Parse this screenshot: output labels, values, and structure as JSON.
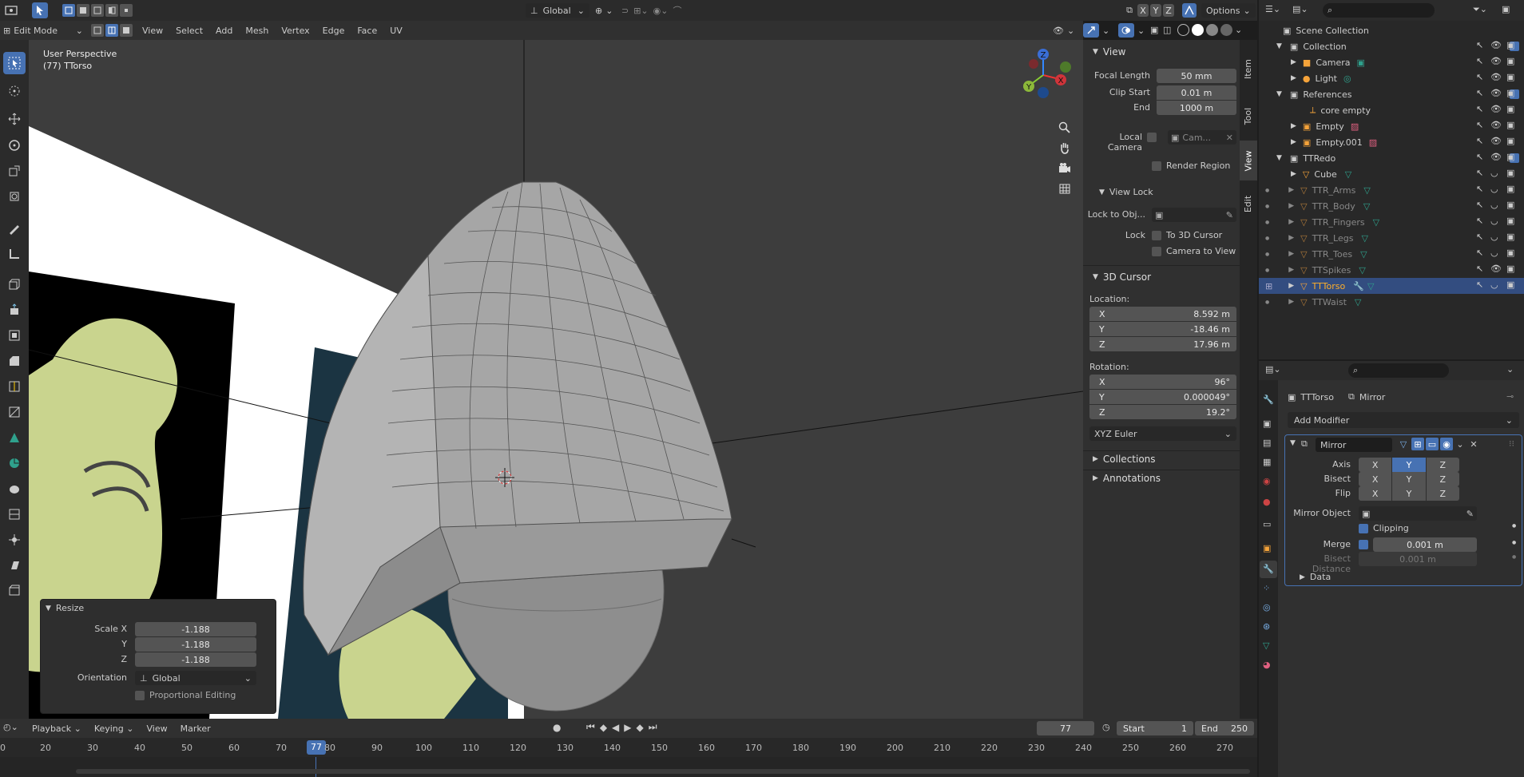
{
  "topbar": {
    "transform_orientation": "Global",
    "axes": [
      "X",
      "Y",
      "Z"
    ],
    "options_label": "Options"
  },
  "header": {
    "mode": "Edit Mode",
    "menus": [
      "View",
      "Select",
      "Add",
      "Mesh",
      "Vertex",
      "Edge",
      "Face",
      "UV"
    ]
  },
  "viewport": {
    "perspective_label": "User Perspective",
    "object_label": "(77) TTorso"
  },
  "resize_panel": {
    "title": "Resize",
    "scale_x_label": "Scale X",
    "y_label": "Y",
    "z_label": "Z",
    "scale_x": "-1.188",
    "scale_y": "-1.188",
    "scale_z": "-1.188",
    "orientation_label": "Orientation",
    "orientation_value": "Global",
    "proportional_label": "Proportional Editing"
  },
  "npanel": {
    "view_title": "View",
    "focal_length_label": "Focal Length",
    "focal_length": "50 mm",
    "clip_start_label": "Clip Start",
    "clip_start": "0.01 m",
    "end_label": "End",
    "clip_end": "1000 m",
    "local_camera_label": "Local Camera",
    "local_camera_value": "Cam...",
    "render_region_label": "Render Region",
    "view_lock_title": "View Lock",
    "lock_to_obj_label": "Lock to Obj...",
    "lock_label": "Lock",
    "to_3d_cursor_label": "To 3D Cursor",
    "camera_to_view_label": "Camera to View",
    "cursor_title": "3D Cursor",
    "location_label": "Location:",
    "loc_x": "8.592 m",
    "loc_y": "-18.46 m",
    "loc_z": "17.96 m",
    "rotation_label": "Rotation:",
    "rot_x": "96°",
    "rot_y": "0.000049°",
    "rot_z": "19.2°",
    "rotation_mode": "XYZ Euler",
    "collections_title": "Collections",
    "annotations_title": "Annotations",
    "axis_x": "X",
    "axis_y": "Y",
    "axis_z": "Z"
  },
  "ntabs": [
    "Item",
    "Tool",
    "View",
    "Edit"
  ],
  "outliner": {
    "rows": [
      {
        "label": "Scene Collection",
        "indent": 0
      },
      {
        "label": "Collection",
        "indent": 1
      },
      {
        "label": "Camera",
        "indent": 2
      },
      {
        "label": "Light",
        "indent": 2
      },
      {
        "label": "References",
        "indent": 1
      },
      {
        "label": "core empty",
        "indent": 2
      },
      {
        "label": "Empty",
        "indent": 2
      },
      {
        "label": "Empty.001",
        "indent": 2
      },
      {
        "label": "TTRedo",
        "indent": 1
      },
      {
        "label": "Cube",
        "indent": 2
      },
      {
        "label": "TTR_Arms",
        "indent": 2
      },
      {
        "label": "TTR_Body",
        "indent": 2
      },
      {
        "label": "TTR_Fingers",
        "indent": 2
      },
      {
        "label": "TTR_Legs",
        "indent": 2
      },
      {
        "label": "TTR_Toes",
        "indent": 2
      },
      {
        "label": "TTSpikes",
        "indent": 2
      },
      {
        "label": "TTTorso",
        "indent": 2
      },
      {
        "label": "TTWaist",
        "indent": 2
      }
    ]
  },
  "props": {
    "object_name": "TTTorso",
    "modifier_crumb": "Mirror",
    "add_modifier_label": "Add Modifier",
    "modifier_name": "Mirror",
    "axis_label": "Axis",
    "bisect_label": "Bisect",
    "flip_label": "Flip",
    "x": "X",
    "y": "Y",
    "z": "Z",
    "mirror_object_label": "Mirror Object",
    "clipping_label": "Clipping",
    "merge_label": "Merge",
    "merge_value": "0.001 m",
    "bisect_distance_label": "Bisect Distance",
    "bisect_distance_value": "0.001 m",
    "data_label": "Data"
  },
  "timeline": {
    "menus": [
      "Playback",
      "Keying",
      "View",
      "Marker"
    ],
    "current_frame": "77",
    "start_label": "Start",
    "start_value": "1",
    "end_label": "End",
    "end_value": "250",
    "ruler": [
      "0",
      "20",
      "30",
      "40",
      "50",
      "60",
      "70",
      "77",
      "80",
      "90",
      "100",
      "110",
      "120",
      "130",
      "140",
      "150",
      "160",
      "170",
      "180",
      "190",
      "200",
      "210",
      "220",
      "230",
      "240",
      "250",
      "260",
      "270"
    ]
  },
  "colors": {
    "accent": "#4772b3",
    "selected_object": "#ffaf29"
  }
}
